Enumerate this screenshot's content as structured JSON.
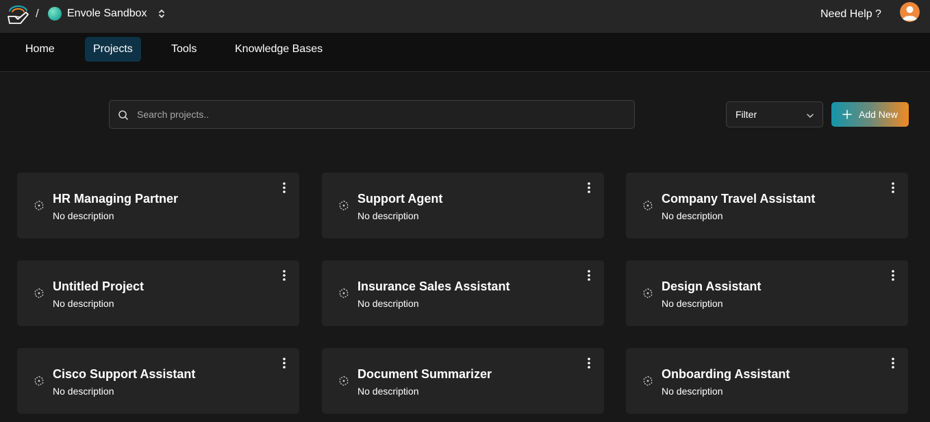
{
  "header": {
    "breadcrumb_separator": "/",
    "workspace_name": "Envole Sandbox",
    "help_label": "Need Help ?"
  },
  "nav": {
    "tabs": [
      {
        "label": "Home",
        "active": false
      },
      {
        "label": "Projects",
        "active": true
      },
      {
        "label": "Tools",
        "active": false
      },
      {
        "label": "Knowledge Bases",
        "active": false
      }
    ]
  },
  "toolbar": {
    "search_placeholder": "Search projects..",
    "search_value": "",
    "filter_label": "Filter",
    "add_label": "Add New"
  },
  "projects": [
    {
      "title": "HR Managing Partner",
      "description": "No description"
    },
    {
      "title": "Support Agent",
      "description": "No description"
    },
    {
      "title": "Company Travel Assistant",
      "description": "No description"
    },
    {
      "title": "Untitled Project",
      "description": "No description"
    },
    {
      "title": "Insurance Sales Assistant",
      "description": "No description"
    },
    {
      "title": "Design Assistant",
      "description": "No description"
    },
    {
      "title": "Cisco Support Assistant",
      "description": "No description"
    },
    {
      "title": "Document Summarizer",
      "description": "No description"
    },
    {
      "title": "Onboarding Assistant",
      "description": "No description"
    }
  ],
  "colors": {
    "background": "#181818",
    "topbar": "#262626",
    "nav": "#101010",
    "card": "#242424",
    "active_tab": "#0e3347",
    "accent_start": "#1496aa",
    "accent_end": "#f08a24"
  },
  "icons": {
    "logo": "hand-wave-logo-icon",
    "workspace": "workspace-dot-icon",
    "switcher": "chevron-updown-icon",
    "avatar": "user-avatar-icon",
    "search": "search-icon",
    "filter": "chevron-down-icon",
    "add": "plus-icon",
    "project": "project-cube-icon",
    "menu": "kebab-menu-icon"
  }
}
